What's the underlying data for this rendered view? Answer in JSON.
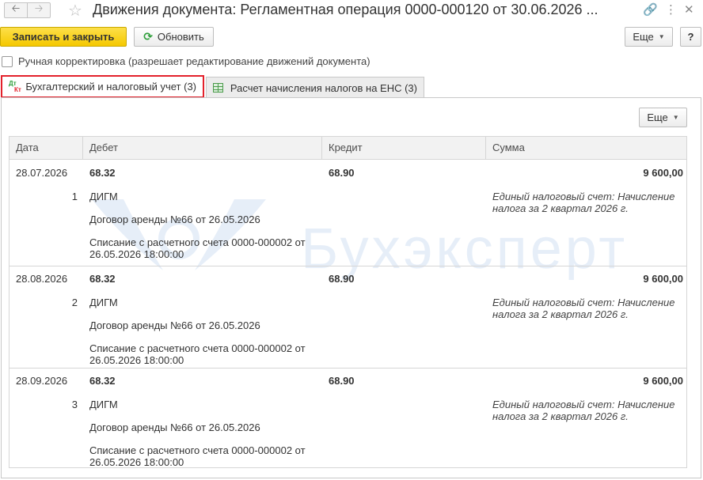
{
  "window": {
    "title": "Движения документа: Регламентная операция 0000-000120 от 30.06.2026 ..."
  },
  "toolbar": {
    "save_close_label": "Записать и закрыть",
    "refresh_label": "Обновить",
    "more_label": "Еще",
    "help_label": "?"
  },
  "manual_edit": {
    "label": "Ручная корректировка (разрешает редактирование движений документа)",
    "checked": false
  },
  "tabs": [
    {
      "label": "Бухгалтерский и налоговый учет (3)",
      "icon": "dt-kt-icon",
      "active": true
    },
    {
      "label": "Расчет начисления налогов на ЕНС (3)",
      "icon": "table-grid-icon",
      "active": false
    }
  ],
  "panel": {
    "more_label": "Еще"
  },
  "watermark": "Бухэксперт",
  "table": {
    "columns": [
      "Дата",
      "Дебет",
      "Кредит",
      "Сумма"
    ],
    "rows": [
      {
        "date": "28.07.2026",
        "num": "1",
        "debit": "68.32",
        "debit_sub1": "ДИГМ",
        "debit_sub2": "Договор аренды №66 от 26.05.2026",
        "debit_sub3": "Списание с расчетного счета 0000-000002 от 26.05.2026 18:00:00",
        "credit": "68.90",
        "sum": "9 600,00",
        "description": "Единый налоговый счет: Начисление налога за 2 квартал 2026 г."
      },
      {
        "date": "28.08.2026",
        "num": "2",
        "debit": "68.32",
        "debit_sub1": "ДИГМ",
        "debit_sub2": "Договор аренды №66 от 26.05.2026",
        "debit_sub3": "Списание с расчетного счета 0000-000002 от 26.05.2026 18:00:00",
        "credit": "68.90",
        "sum": "9 600,00",
        "description": "Единый налоговый счет: Начисление налога за 2 квартал 2026 г."
      },
      {
        "date": "28.09.2026",
        "num": "3",
        "debit": "68.32",
        "debit_sub1": "ДИГМ",
        "debit_sub2": "Договор аренды №66 от 26.05.2026",
        "debit_sub3": "Списание с расчетного счета 0000-000002 от 26.05.2026 18:00:00",
        "credit": "68.90",
        "sum": "9 600,00",
        "description": "Единый налоговый счет: Начисление налога за 2 квартал 2026 г."
      }
    ]
  }
}
